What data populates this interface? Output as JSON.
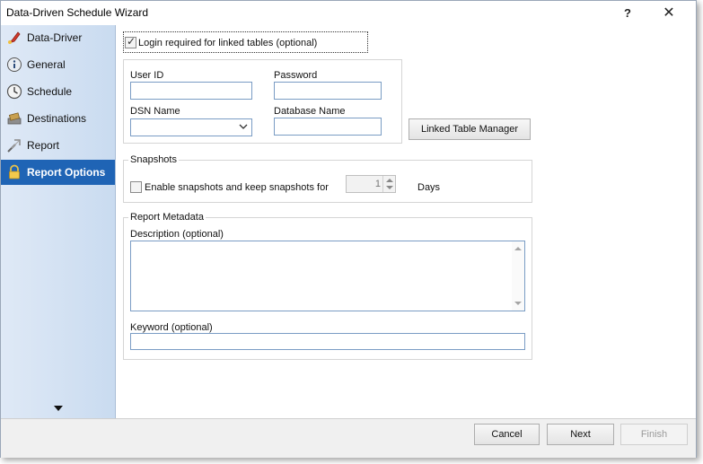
{
  "window": {
    "title": "Data-Driven Schedule Wizard",
    "help_label": "?",
    "close_label": "✕"
  },
  "sidebar": {
    "items": [
      {
        "label": "Data-Driver",
        "icon": "data-driver-icon"
      },
      {
        "label": "General",
        "icon": "info-icon"
      },
      {
        "label": "Schedule",
        "icon": "clock-icon"
      },
      {
        "label": "Destinations",
        "icon": "destinations-icon"
      },
      {
        "label": "Report",
        "icon": "report-icon"
      },
      {
        "label": "Report Options",
        "icon": "lock-icon",
        "active": true
      }
    ]
  },
  "login": {
    "checkbox_label": "Login required for linked  tables (optional)",
    "checked": true,
    "user_id_label": "User ID",
    "user_id_value": "",
    "password_label": "Password",
    "password_value": "",
    "dsn_label": "DSN Name",
    "dsn_value": "",
    "database_label": "Database Name",
    "database_value": "",
    "linked_table_button": "Linked Table Manager"
  },
  "snapshots": {
    "title": "Snapshots",
    "checkbox_label": "Enable snapshots and keep snapshots for",
    "checked": false,
    "value": "1",
    "unit": "Days"
  },
  "metadata": {
    "title": "Report Metadata",
    "description_label": "Description (optional)",
    "description_value": "",
    "keyword_label": "Keyword (optional)",
    "keyword_value": ""
  },
  "footer": {
    "cancel_label": "Cancel",
    "next_label": "Next",
    "finish_label": "Finish"
  },
  "colors": {
    "active_nav": "#1f64b5",
    "sidebar_bg": "#d4e2f3",
    "input_border": "#7a9cc4"
  }
}
